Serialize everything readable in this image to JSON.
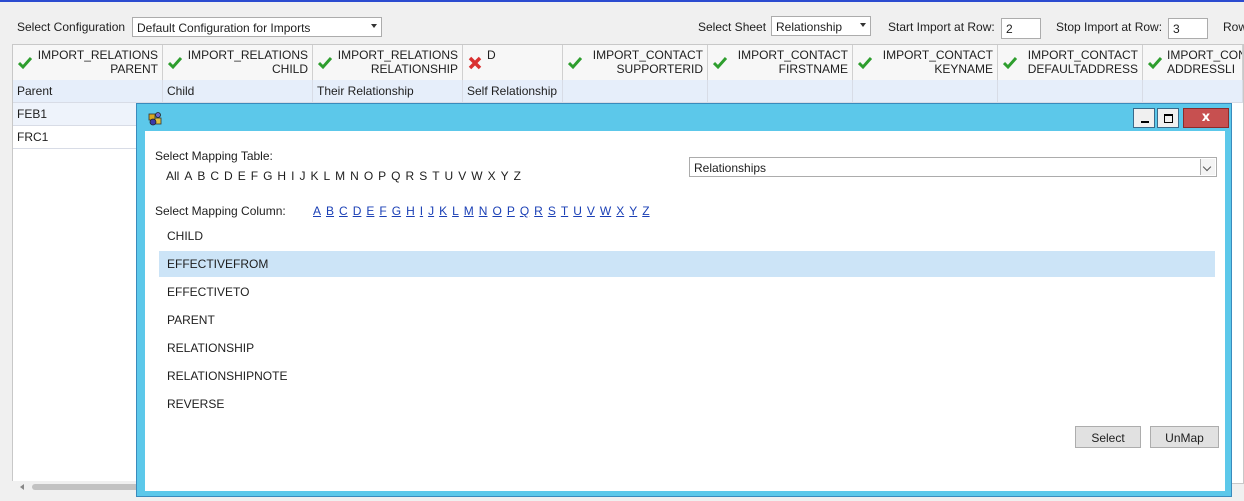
{
  "toolbar": {
    "config_label": "Select Configuration",
    "config_value": "Default Configuration for Imports",
    "sheet_label": "Select Sheet",
    "sheet_value": "Relationship",
    "start_label": "Start Import at Row:",
    "start_value": "2",
    "stop_label": "Stop Import at Row:",
    "stop_value": "3",
    "row_label": "Row"
  },
  "grid": {
    "headers": [
      {
        "line1": "IMPORT_RELATIONS",
        "line2": "PARENT",
        "status": "check"
      },
      {
        "line1": "IMPORT_RELATIONS",
        "line2": "CHILD",
        "status": "check"
      },
      {
        "line1": "IMPORT_RELATIONS",
        "line2": "RELATIONSHIP",
        "status": "check"
      },
      {
        "line1": "D",
        "line2": "",
        "status": "error"
      },
      {
        "line1": "IMPORT_CONTACT",
        "line2": "SUPPORTERID",
        "status": "check"
      },
      {
        "line1": "IMPORT_CONTACT",
        "line2": "FIRSTNAME",
        "status": "check"
      },
      {
        "line1": "IMPORT_CONTACT",
        "line2": "KEYNAME",
        "status": "check"
      },
      {
        "line1": "IMPORT_CONTACT",
        "line2": "DEFAULTADDRESS",
        "status": "check"
      },
      {
        "line1": "IMPORT_CON",
        "line2": "ADDRESSLI",
        "status": "check"
      }
    ],
    "rows": [
      [
        "Parent",
        "Child",
        "Their Relationship",
        "Self Relationship",
        "",
        "",
        "",
        "",
        ""
      ],
      [
        "FEB1",
        "",
        "",
        "",
        "",
        "",
        "",
        "",
        ""
      ],
      [
        "FRC1",
        "",
        "",
        "",
        "",
        "",
        "",
        "",
        ""
      ]
    ]
  },
  "dialog": {
    "table_label": "Select Mapping Table:",
    "table_letters": [
      "All",
      "A",
      "B",
      "C",
      "D",
      "E",
      "F",
      "G",
      "H",
      "I",
      "J",
      "K",
      "L",
      "M",
      "N",
      "O",
      "P",
      "Q",
      "R",
      "S",
      "T",
      "U",
      "V",
      "W",
      "X",
      "Y",
      "Z"
    ],
    "table_value": "Relationships",
    "column_label": "Select Mapping Column:",
    "column_letters": [
      "A",
      "B",
      "C",
      "D",
      "E",
      "F",
      "G",
      "H",
      "I",
      "J",
      "K",
      "L",
      "M",
      "N",
      "O",
      "P",
      "Q",
      "R",
      "S",
      "T",
      "U",
      "V",
      "W",
      "X",
      "Y",
      "Z"
    ],
    "columns": [
      "CHILD",
      "EFFECTIVEFROM",
      "EFFECTIVETO",
      "PARENT",
      "RELATIONSHIP",
      "RELATIONSHIPNOTE",
      "REVERSE"
    ],
    "selected_column": "EFFECTIVEFROM",
    "select_button": "Select",
    "unmap_button": "UnMap",
    "close_glyph": "x"
  },
  "colors": {
    "dialog_frame": "#5cc8ea",
    "selected_row": "#cce4f7",
    "close_button": "#c75050",
    "link": "#1a3fb5",
    "check": "#2e9e2e",
    "error": "#d93030"
  }
}
